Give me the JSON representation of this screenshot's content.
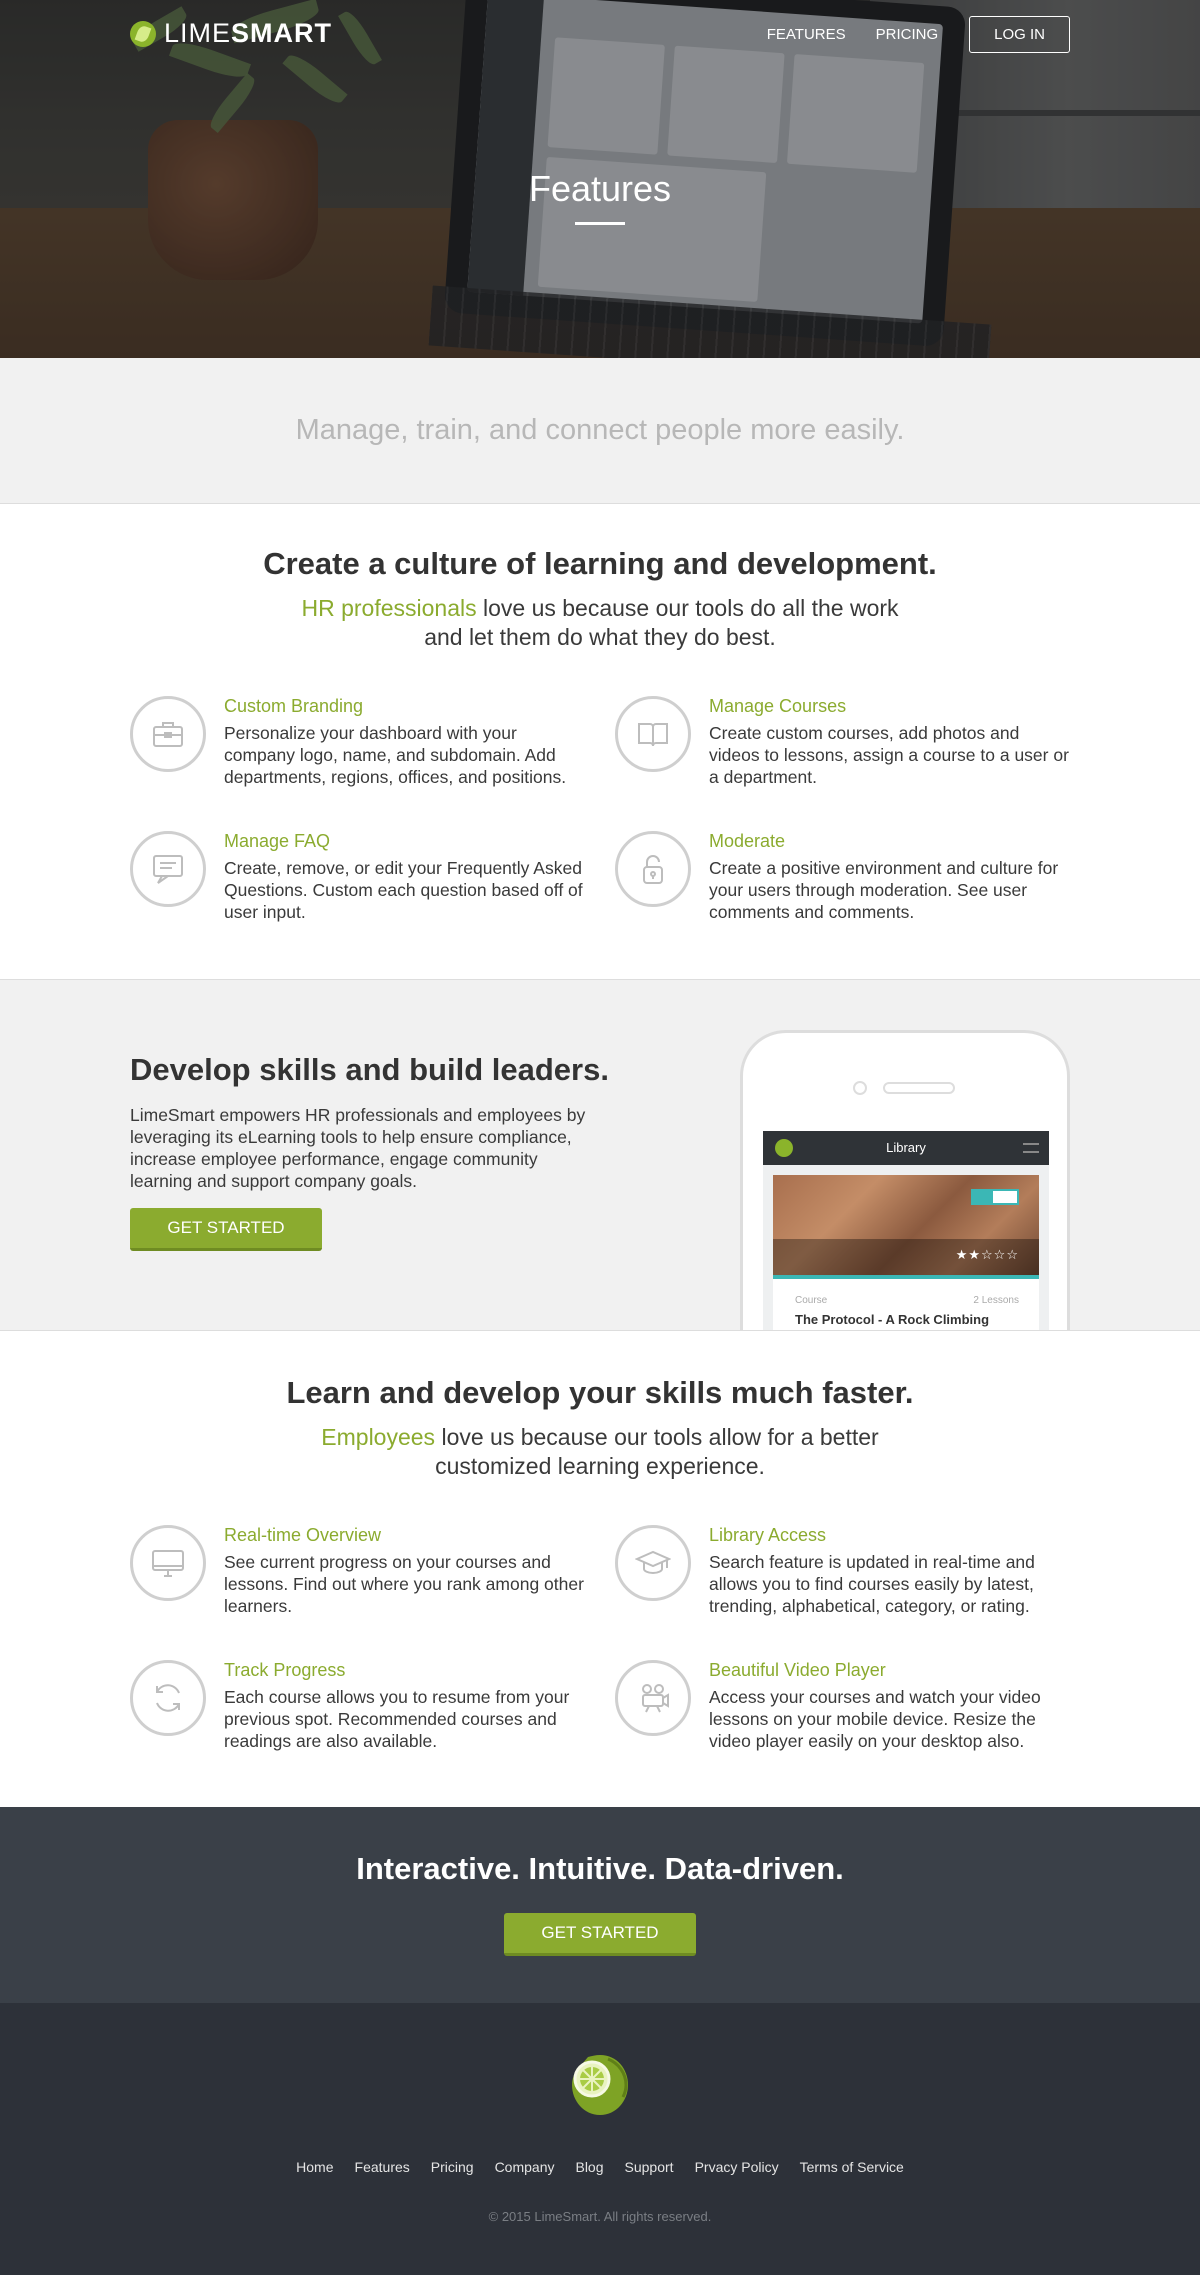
{
  "brand": {
    "name_light": "LIME",
    "name_bold": "SMART"
  },
  "nav": {
    "features": "FEATURES",
    "pricing": "PRICING",
    "login": "LOG IN"
  },
  "hero": {
    "title": "Features"
  },
  "tagline": "Manage, train, and connect people more easily.",
  "culture": {
    "title": "Create a culture of learning and development.",
    "sub_highlight": "HR professionals",
    "sub_rest": " love us because our tools do all the work and let them do what they do best.",
    "items": [
      {
        "title": "Custom Branding",
        "text": "Personalize your dashboard with your company logo, name, and subdomain. Add departments, regions, offices, and positions.",
        "icon": "briefcase-icon"
      },
      {
        "title": "Manage Courses",
        "text": "Create custom courses, add photos and videos to lessons, assign a course to a user or a department.",
        "icon": "book-icon"
      },
      {
        "title": "Manage FAQ",
        "text": "Create, remove, or edit your Frequently Asked Questions. Custom each question based off of user input.",
        "icon": "chat-icon"
      },
      {
        "title": "Moderate",
        "text": "Create a positive environment and culture for your users through moderation. See user comments and comments.",
        "icon": "lock-icon"
      }
    ]
  },
  "develop": {
    "title": "Develop skills and build leaders.",
    "text": "LimeSmart empowers HR professionals and employees by leveraging its eLearning tools to help ensure compliance, increase employee performance, engage community learning and support company goals.",
    "button": "GET STARTED",
    "phone": {
      "app_title": "Library",
      "course_label": "Course",
      "lessons": "2 Lessons",
      "course_title": "The Protocol - A Rock Climbing",
      "stars": "★★☆☆☆"
    }
  },
  "learn": {
    "title": "Learn and develop your skills much faster.",
    "sub_highlight": "Employees",
    "sub_rest": " love us because our tools allow for a better customized learning experience.",
    "items": [
      {
        "title": "Real-time Overview",
        "text": "See current progress on your courses and lessons. Find out where you rank among other learners.",
        "icon": "monitor-icon"
      },
      {
        "title": "Library Access",
        "text": "Search feature is updated in real-time and allows you to find courses easily by latest, trending, alphabetical, category, or rating.",
        "icon": "graduation-cap-icon"
      },
      {
        "title": "Track Progress",
        "text": "Each course allows you to resume from your previous spot. Recommended courses and readings are also available.",
        "icon": "refresh-icon"
      },
      {
        "title": "Beautiful Video Player",
        "text": "Access your courses and watch your video lessons on your mobile device. Resize the video player easily on your desktop also.",
        "icon": "video-camera-icon"
      }
    ]
  },
  "cta": {
    "title": "Interactive. Intuitive. Data-driven.",
    "button": "GET STARTED"
  },
  "footer": {
    "links": [
      "Home",
      "Features",
      "Pricing",
      "Company",
      "Blog",
      "Support",
      "Prvacy Policy",
      "Terms of Service"
    ],
    "copyright": "© 2015 LimeSmart. All rights reserved."
  },
  "colors": {
    "accent": "#8bab2f",
    "dark": "#3a4048",
    "footer": "#2d3139",
    "tint": "#f1f1f1"
  }
}
